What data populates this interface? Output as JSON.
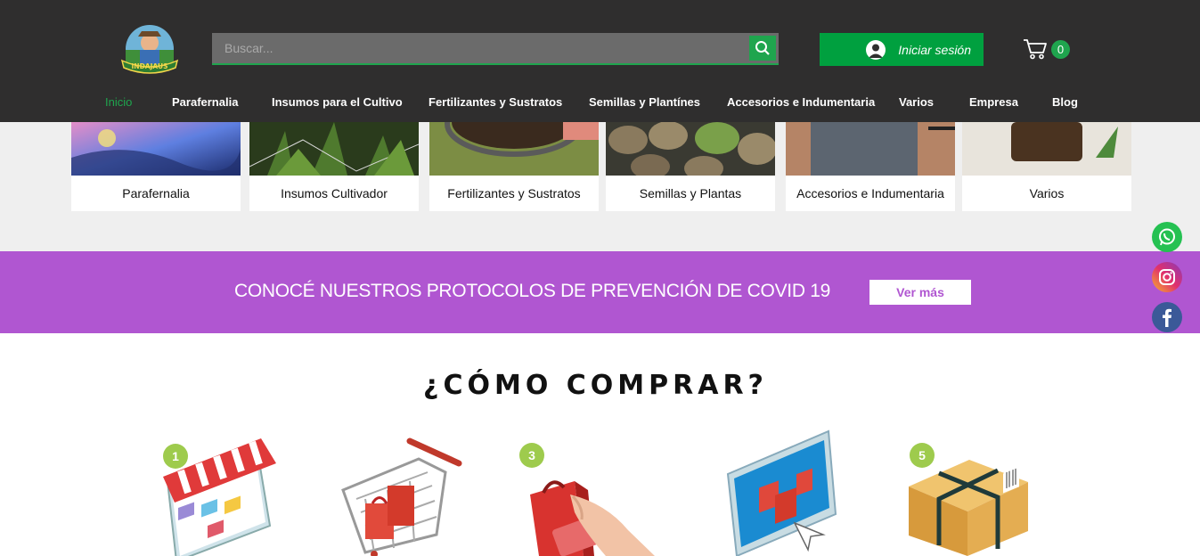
{
  "header": {
    "logo_text": "INDAJAUS",
    "search_placeholder": "Buscar...",
    "login_label": "Iniciar sesión",
    "cart_count": "0"
  },
  "nav": [
    {
      "label": "Inicio",
      "active": true
    },
    {
      "label": "Parafernalia"
    },
    {
      "label": "Insumos para el Cultivo"
    },
    {
      "label": "Fertilizantes y Sustratos"
    },
    {
      "label": "Semillas y Plantínes"
    },
    {
      "label": "Accesorios e Indumentaria"
    },
    {
      "label": "Varios"
    },
    {
      "label": "Empresa"
    },
    {
      "label": "Blog"
    }
  ],
  "categories": [
    {
      "label": "Parafernalia"
    },
    {
      "label": "Insumos Cultivador"
    },
    {
      "label": "Fertilizantes y Sustratos"
    },
    {
      "label": "Semillas y Plantas"
    },
    {
      "label": "Accesorios e Indumentaria"
    },
    {
      "label": "Varios"
    }
  ],
  "banner": {
    "text": "CONOCÉ NUESTROS PROTOCOLOS DE PREVENCIÓN DE COVID 19",
    "button": "Ver más"
  },
  "social": [
    "whatsapp-icon",
    "instagram-icon",
    "facebook-icon"
  ],
  "how_to_buy": {
    "title": "¿CÓMO COMPRAR?",
    "steps": [
      "1",
      "3",
      "5"
    ]
  },
  "colors": {
    "header_bg": "#2f2e2e",
    "accent_green": "#1fa54e",
    "banner_purple": "#b056d1",
    "step_badge": "#9ecb4d"
  }
}
